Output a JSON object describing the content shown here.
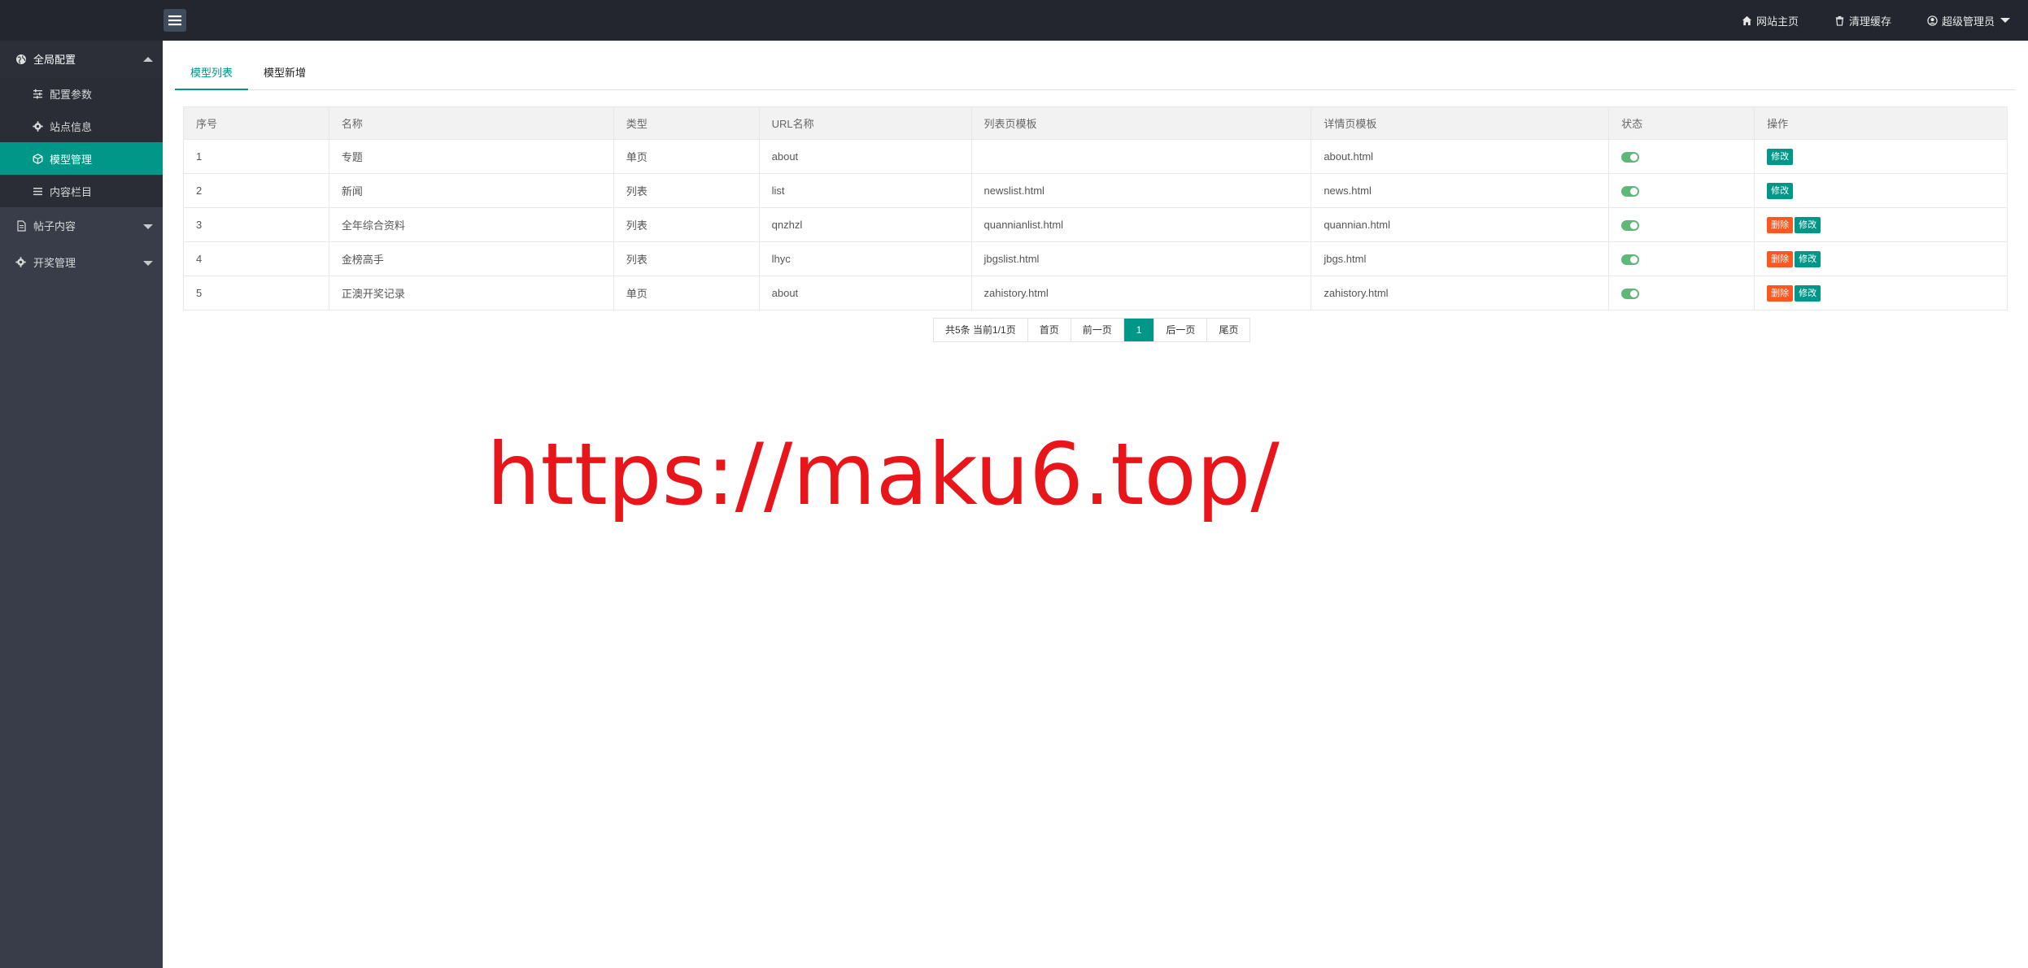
{
  "header": {
    "home_label": "网站主页",
    "cache_label": "清理缓存",
    "user_label": "超级管理员"
  },
  "sidebar": {
    "groups": [
      {
        "label": "全局配置",
        "icon": "globe-icon",
        "open": true,
        "children": [
          {
            "label": "配置参数",
            "icon": "sliders-icon"
          },
          {
            "label": "站点信息",
            "icon": "gear-icon"
          },
          {
            "label": "模型管理",
            "icon": "cube-icon",
            "active": true
          },
          {
            "label": "内容栏目",
            "icon": "list-icon"
          }
        ]
      },
      {
        "label": "帖子内容",
        "icon": "file-icon"
      },
      {
        "label": "开奖管理",
        "icon": "gear-icon"
      }
    ]
  },
  "tabs": [
    {
      "label": "模型列表",
      "active": true
    },
    {
      "label": "模型新增"
    }
  ],
  "table": {
    "headers": [
      "序号",
      "名称",
      "类型",
      "URL名称",
      "列表页模板",
      "详情页模板",
      "状态",
      "操作"
    ],
    "rows": [
      {
        "id": "1",
        "name": "专题",
        "type": "单页",
        "url": "about",
        "list_tpl": "",
        "detail_tpl": "about.html",
        "enabled": true,
        "can_delete": false
      },
      {
        "id": "2",
        "name": "新闻",
        "type": "列表",
        "url": "list",
        "list_tpl": "newslist.html",
        "detail_tpl": "news.html",
        "enabled": true,
        "can_delete": false
      },
      {
        "id": "3",
        "name": "全年综合资料",
        "type": "列表",
        "url": "qnzhzl",
        "list_tpl": "quannianlist.html",
        "detail_tpl": "quannian.html",
        "enabled": true,
        "can_delete": true
      },
      {
        "id": "4",
        "name": "金榜高手",
        "type": "列表",
        "url": "lhyc",
        "list_tpl": "jbgslist.html",
        "detail_tpl": "jbgs.html",
        "enabled": true,
        "can_delete": true
      },
      {
        "id": "5",
        "name": "正澳开奖记录",
        "type": "单页",
        "url": "about",
        "list_tpl": "zahistory.html",
        "detail_tpl": "zahistory.html",
        "enabled": true,
        "can_delete": true
      }
    ],
    "edit_label": "修改",
    "delete_label": "删除"
  },
  "pager": {
    "count_label": "共5条 当前1/1页",
    "first": "首页",
    "prev": "前一页",
    "current": "1",
    "next": "后一页",
    "last": "尾页"
  },
  "watermark": "https://maku6.top/",
  "colors": {
    "accent": "#009688",
    "danger": "#ff5722",
    "topbar": "#23262e",
    "sidebar": "#393d49",
    "watermark": "#e8161b"
  }
}
